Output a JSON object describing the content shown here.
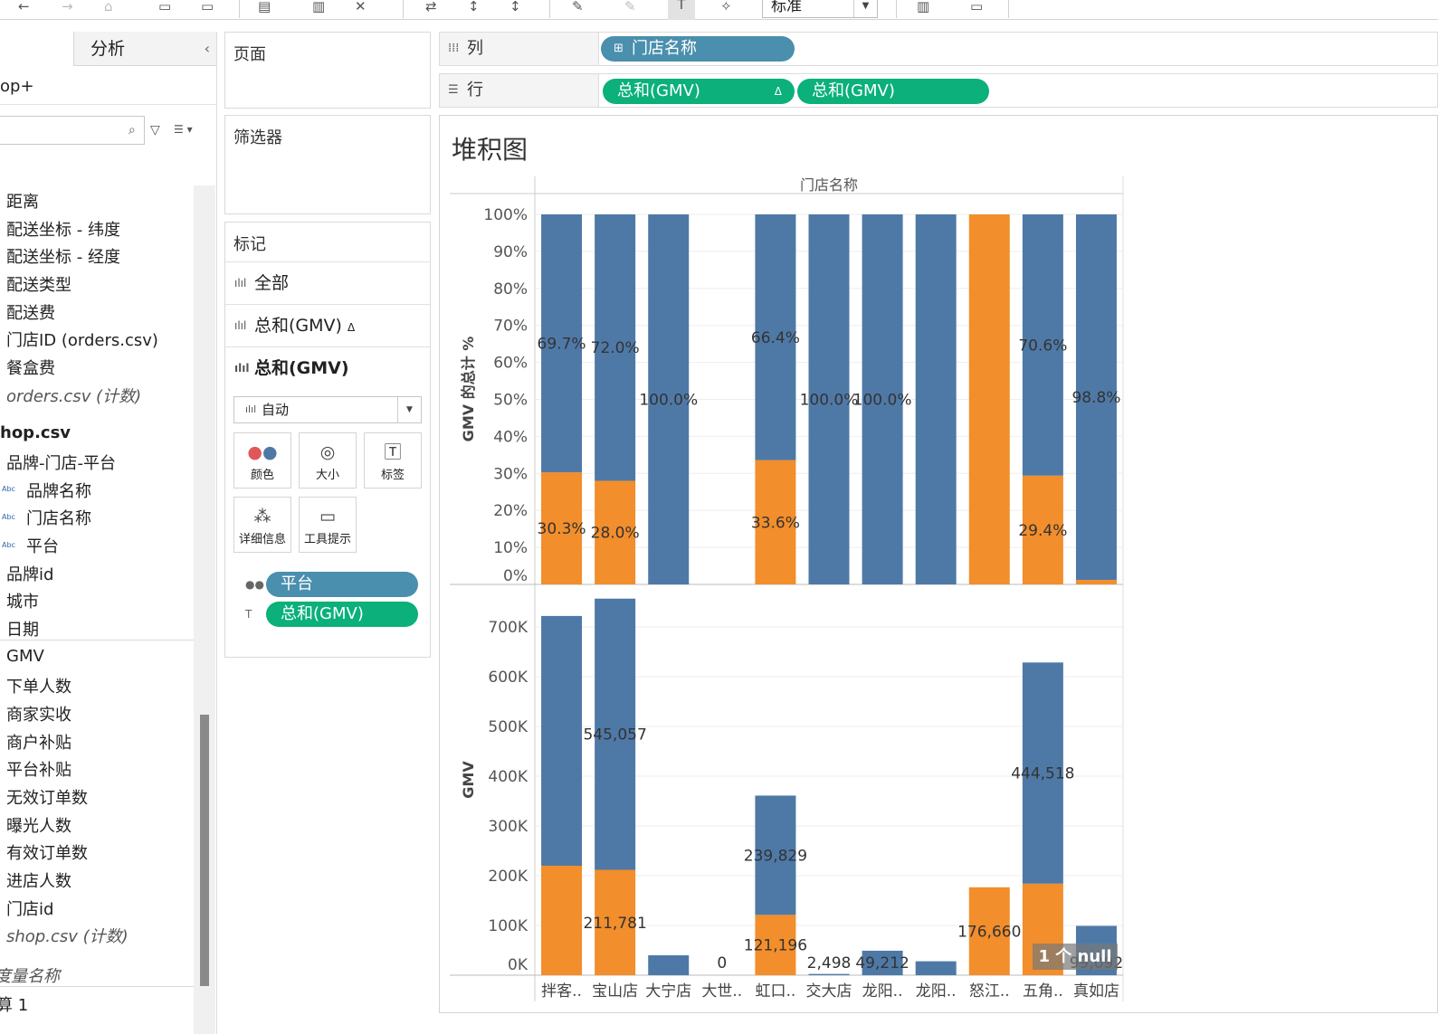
{
  "toolbar": {
    "mark_size_select": "标准",
    "icons": [
      "back-arrow-icon",
      "forward-arrow-icon",
      "redo-icon",
      "save-icon",
      "new-sheet-icon",
      "new-worksheet-icon",
      "duplicate-icon",
      "clear-icon",
      "swap-icon",
      "sort-asc-icon",
      "sort-desc-icon",
      "highlight-icon",
      "pen-icon",
      "label-icon",
      "pin-icon",
      "chart-type-icon",
      "present-icon"
    ]
  },
  "left_pane": {
    "tab_analysis": "分析",
    "collapse": "‹",
    "datasource": "op+",
    "fields_orders": [
      "距离",
      "配送坐标 - 纬度",
      "配送坐标 - 经度",
      "配送类型",
      "配送费",
      "门店ID (orders.csv)",
      "餐盒费"
    ],
    "orders_count": "orders.csv (计数)",
    "shop_table": "hop.csv",
    "dimensions_shop": [
      "品牌-门店-平台",
      "品牌名称",
      "门店名称",
      "平台",
      "品牌id",
      "城市",
      "日期"
    ],
    "abc_badge": "Abc",
    "measures": [
      "GMV",
      "下单人数",
      "商家实收",
      "商户补贴",
      "平台补贴",
      "无效订单数",
      "曝光人数",
      "有效订单数",
      "进店人数",
      "门店id"
    ],
    "shop_count": "shop.csv (计数)",
    "measure_names": "度量名称",
    "calc": "算 1"
  },
  "cards": {
    "pages": "页面",
    "filters": "筛选器",
    "marks": "标记",
    "mark_rows": [
      "全部",
      "总和(GMV)",
      "总和(GMV)"
    ],
    "delta": "Δ",
    "mark_type": "自动",
    "buttons": [
      "颜色",
      "大小",
      "标签",
      "详细信息",
      "工具提示"
    ],
    "mark_pills": [
      "平台",
      "总和(GMV)"
    ]
  },
  "shelves": {
    "columns_label": "列",
    "rows_label": "行",
    "columns_pill": "门店名称",
    "rows_pills": [
      "总和(GMV)",
      "总和(GMV)"
    ],
    "delta": "Δ"
  },
  "sheet": {
    "title": "堆积图",
    "null_badge": "1 个 null"
  },
  "colors": {
    "blue_series": "#4e79a7",
    "orange_series": "#f28e2b",
    "pill_blue": "#4a8fad",
    "pill_green": "#0bb07a"
  },
  "chart_data": [
    {
      "type": "bar",
      "stacked": true,
      "title": "",
      "xlabel": "门店名称",
      "ylabel": "GMV 的总计 %",
      "ylim": [
        0,
        100
      ],
      "yticks": [
        "0%",
        "10%",
        "20%",
        "30%",
        "40%",
        "50%",
        "60%",
        "70%",
        "80%",
        "90%",
        "100%"
      ],
      "categories": [
        "拌客..",
        "宝山店",
        "大宁店",
        "大世..",
        "虹口..",
        "交大店",
        "龙阳..",
        "龙阳..",
        "怒江..",
        "五角..",
        "真如店"
      ],
      "series": [
        {
          "color": "#f28e2b",
          "values": [
            30.3,
            28.0,
            0,
            0,
            33.6,
            0,
            0,
            0,
            100,
            29.4,
            1.2
          ]
        },
        {
          "color": "#4e79a7",
          "values": [
            69.7,
            72.0,
            100.0,
            0,
            66.4,
            100.0,
            100.0,
            100.0,
            0,
            70.6,
            98.8
          ]
        }
      ],
      "data_labels": [
        {
          "category": "拌客..",
          "text": "69.7%",
          "series": 1
        },
        {
          "category": "拌客..",
          "text": "30.3%",
          "series": 0
        },
        {
          "category": "宝山店",
          "text": "72.0%",
          "series": 1
        },
        {
          "category": "宝山店",
          "text": "28.0%",
          "series": 0
        },
        {
          "category": "大宁店",
          "text": "100.0%",
          "series": 1
        },
        {
          "category": "虹口..",
          "text": "66.4%",
          "series": 1
        },
        {
          "category": "虹口..",
          "text": "33.6%",
          "series": 0
        },
        {
          "category": "交大店",
          "text": "100.0%",
          "series": 1
        },
        {
          "category": "龙阳..",
          "text": "100.0%",
          "series": 1
        },
        {
          "category": "五角..",
          "text": "70.6%",
          "series": 1
        },
        {
          "category": "五角..",
          "text": "29.4%",
          "series": 0
        },
        {
          "category": "真如店",
          "text": "98.8%",
          "series": 1
        }
      ],
      "grid": true
    },
    {
      "type": "bar",
      "stacked": true,
      "title": "",
      "xlabel": "",
      "ylabel": "GMV",
      "ylim": [
        0,
        760000
      ],
      "yticks": [
        "0K",
        "100K",
        "200K",
        "300K",
        "400K",
        "500K",
        "600K",
        "700K"
      ],
      "categories": [
        "拌客..",
        "宝山店",
        "大宁店",
        "大世..",
        "虹口..",
        "交大店",
        "龙阳..",
        "龙阳..",
        "怒江..",
        "五角..",
        "真如店"
      ],
      "series": [
        {
          "color": "#f28e2b",
          "values": [
            220000,
            211781,
            0,
            0,
            121196,
            0,
            0,
            0,
            176660,
            184000,
            0
          ]
        },
        {
          "color": "#4e79a7",
          "values": [
            502000,
            545057,
            40000,
            0,
            239829,
            2498,
            49212,
            28000,
            0,
            444518,
            99092
          ]
        }
      ],
      "data_labels": [
        "545,057",
        "211,781",
        "0",
        "239,829",
        "121,196",
        "2,498",
        "49,212",
        "176,660",
        "444,518",
        "99,092"
      ],
      "grid": true
    }
  ]
}
